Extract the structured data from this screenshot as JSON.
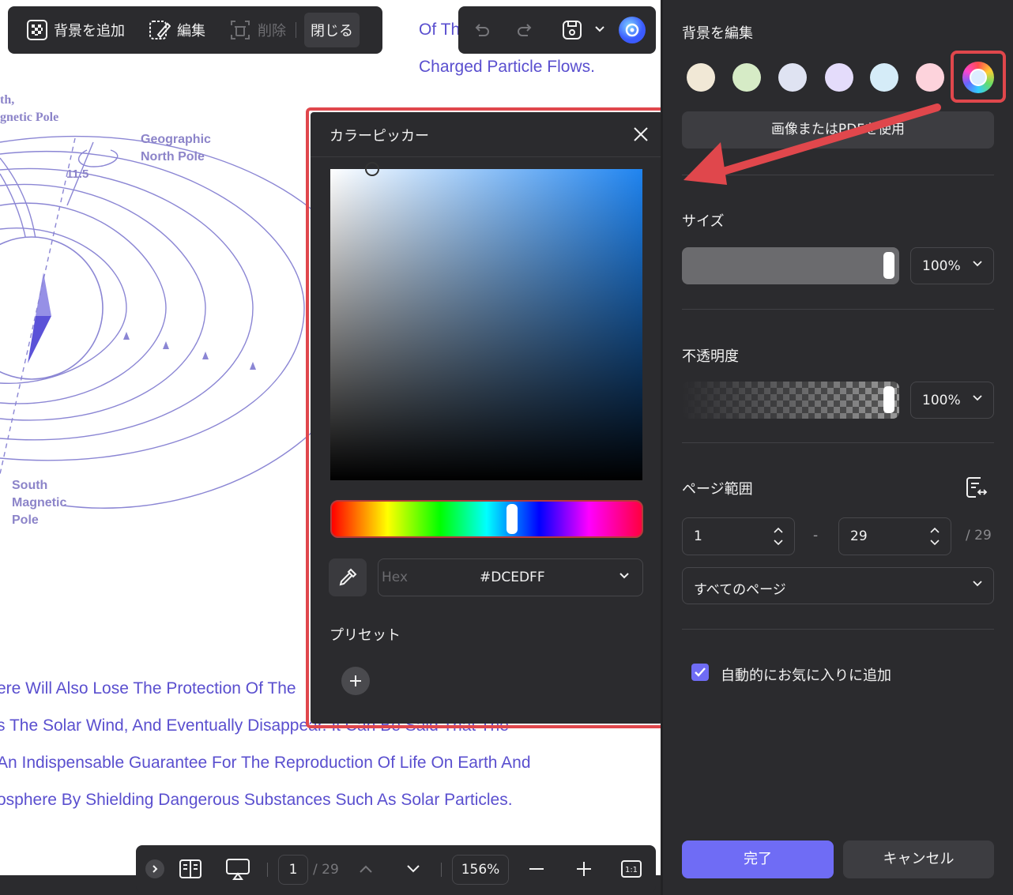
{
  "toolbar": {
    "add_background": "背景を追加",
    "edit": "編集",
    "delete": "削除",
    "close": "閉じる"
  },
  "document": {
    "top_fragment": "Of Th",
    "line_charged": "Charged Particle Flows.",
    "diagram": {
      "north_magnetic_1": "th,",
      "north_magnetic_2": "gnetic Pole",
      "geographic_north_1": "Geographic",
      "geographic_north_2": "North Pole",
      "angle": "11.5",
      "south_1": "South",
      "south_2": "Magnetic",
      "south_3": "Pole"
    },
    "lines": [
      "ere Will Also Lose The Protection Of The",
      "s The Solar Wind, And Eventually Disappear. It Can Be Said That The",
      "An Indispensable Guarantee For The Reproduction Of Life On Earth And",
      "osphere By Shielding Dangerous Substances Such As Solar Particles."
    ]
  },
  "color_picker": {
    "title": "カラーピッカー",
    "hex_label": "Hex",
    "hex_value": "#DCEDFF",
    "preset_label": "プリセット",
    "hue_fraction": 0.58
  },
  "bottom_bar": {
    "page_current": "1",
    "page_total": "/ 29",
    "zoom": "156%"
  },
  "panel": {
    "title": "背景を編集",
    "swatch_colors": [
      "#f1e8d6",
      "#d6ebc6",
      "#dfe3f2",
      "#e4dcfb",
      "#d5ecf8",
      "#fdd3dc"
    ],
    "image_button": "画像またはPDFを使用",
    "size_label": "サイズ",
    "size_value": "100%",
    "opacity_label": "不透明度",
    "opacity_value": "100%",
    "page_range_label": "ページ範囲",
    "range_from": "1",
    "range_dash": "-",
    "range_to": "29",
    "range_total": "/ 29",
    "pages_option": "すべてのページ",
    "favorite_label": "自動的にお気に入りに追加",
    "favorite_checked": true,
    "done": "完了",
    "cancel": "キャンセル"
  },
  "colors": {
    "accent": "#6f6cf5",
    "highlight": "#e0474c",
    "doc_text": "#5a4fcf",
    "panel_bg": "#2b2b2e"
  }
}
